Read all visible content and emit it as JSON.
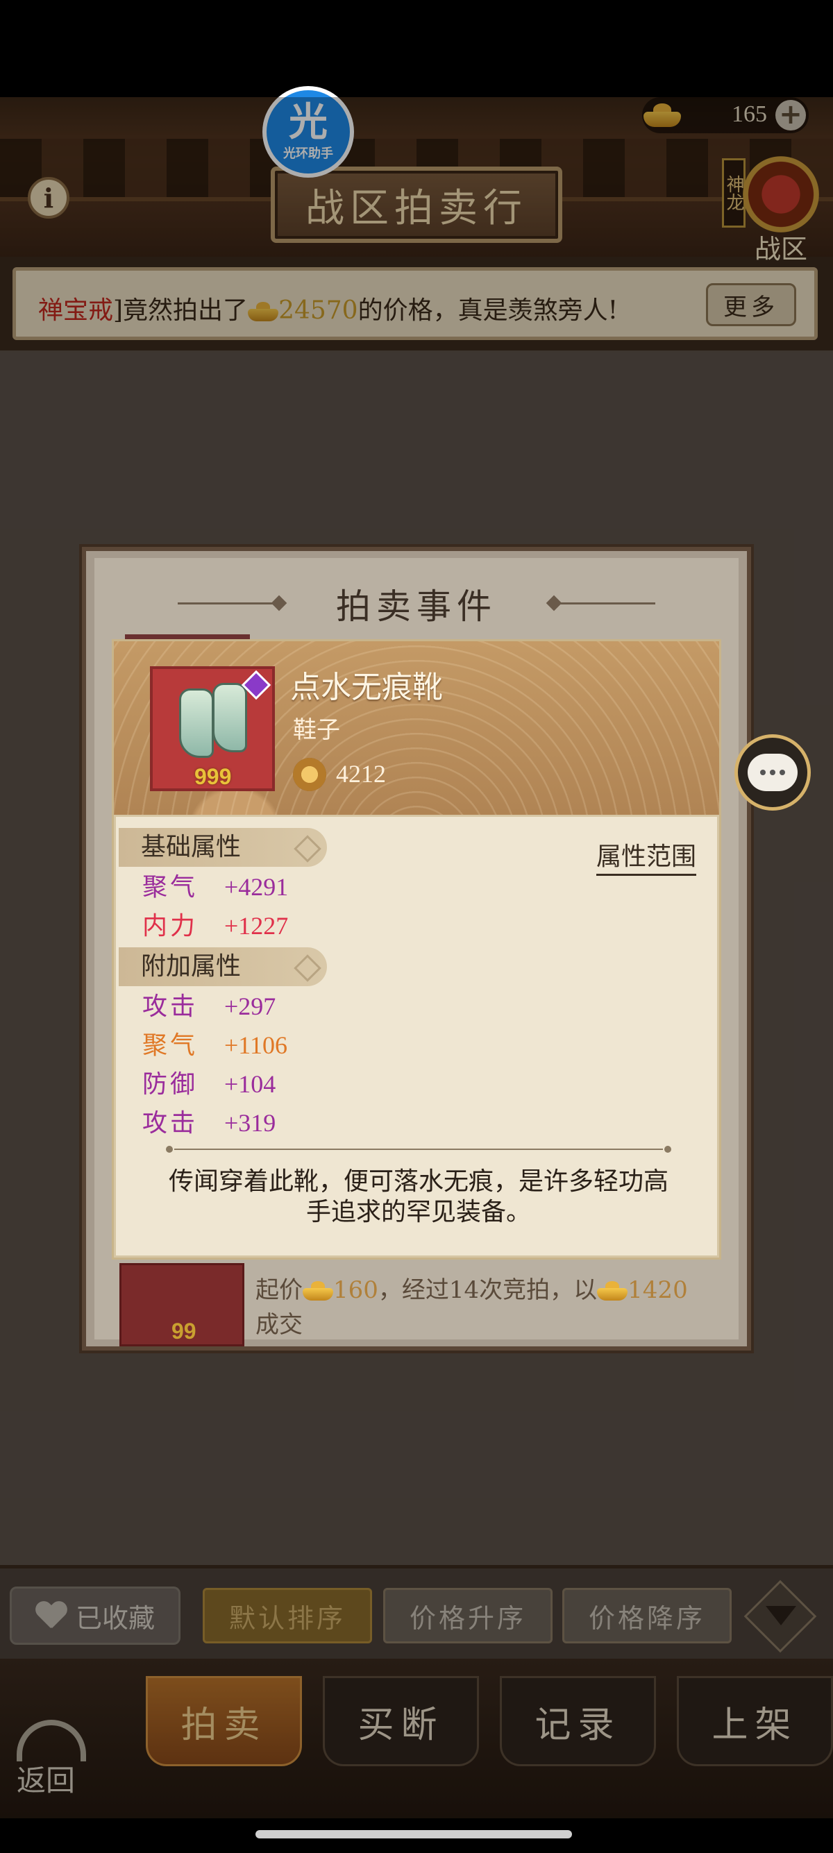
{
  "header": {
    "title": "战区拍卖行",
    "info_icon": "info-icon",
    "currency_amount": "165",
    "server_tag": "神龙",
    "server_label": "战区",
    "logo_big": "光",
    "logo_small": "光环助手"
  },
  "marquee": {
    "item_name": "禅宝戒",
    "text_before": "]竟然拍出了",
    "price": "24570",
    "text_after": "的价格，真是羡煞旁人!",
    "more_label": "更多"
  },
  "dialog": {
    "title": "拍卖事件",
    "item": {
      "name": "点水无痕靴",
      "type": "鞋子",
      "quantity": "999",
      "power": "4212"
    },
    "base_section_label": "基础属性",
    "attr_range_label": "属性范围",
    "base_attrs": [
      {
        "name": "聚气",
        "value": "+4291",
        "color": "#9a2c9c"
      },
      {
        "name": "内力",
        "value": "+1227",
        "color": "#e0304a"
      }
    ],
    "extra_section_label": "附加属性",
    "extra_attrs": [
      {
        "name": "攻击",
        "value": "+297",
        "color": "#9a2c9c"
      },
      {
        "name": "聚气",
        "value": "+1106",
        "color": "#e07826"
      },
      {
        "name": "防御",
        "value": "+104",
        "color": "#9a2c9c"
      },
      {
        "name": "攻击",
        "value": "+319",
        "color": "#9a2c9c"
      }
    ],
    "description": "传闻穿着此靴，便可落水无痕，是许多轻功高手追求的罕见装备。",
    "background_entry": {
      "qty": "99",
      "line1_prefix": "起价",
      "start_price": "160",
      "line1_mid": "，经过14次竞拍，以",
      "final_price": "1420",
      "line2": "成交"
    }
  },
  "sortbar": {
    "favorites_label": "已收藏",
    "sort_default": "默认排序",
    "sort_price_asc": "价格升序",
    "sort_price_desc": "价格降序"
  },
  "tabs": {
    "auction": "拍卖",
    "buyout": "买断",
    "records": "记录",
    "list": "上架",
    "back": "返回"
  }
}
